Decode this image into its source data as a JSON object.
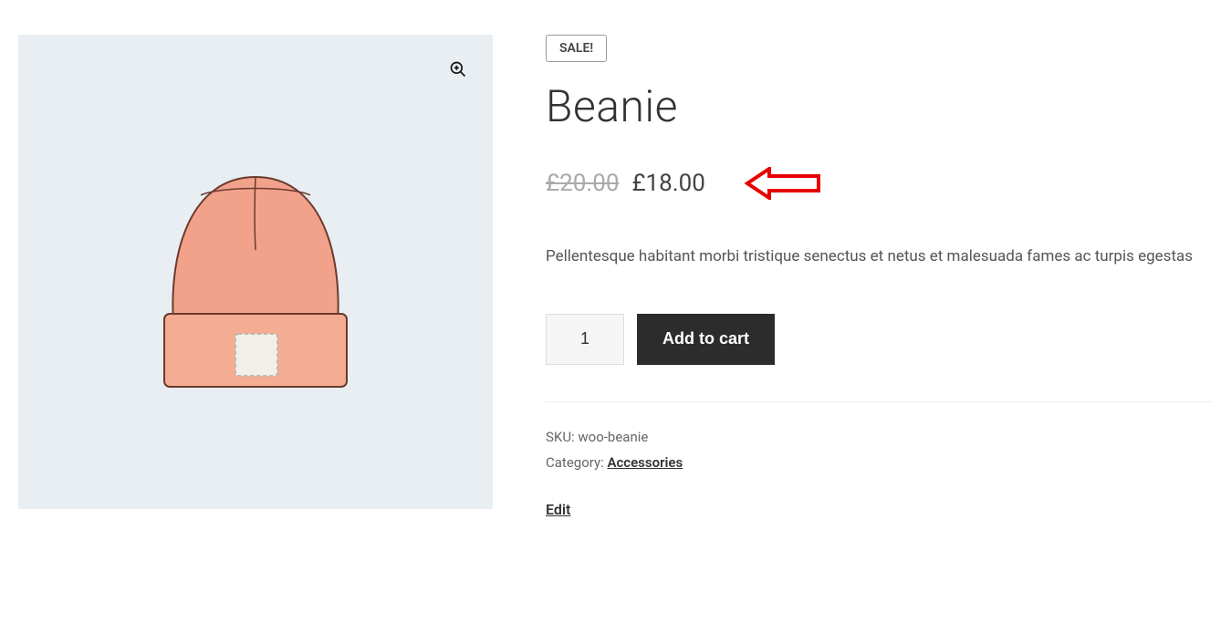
{
  "product": {
    "sale_badge": "SALE!",
    "title": "Beanie",
    "price_old": "£20.00",
    "price_new": "£18.00",
    "description": "Pellentesque habitant morbi tristique senectus et netus et malesuada fames ac turpis egestas",
    "quantity": "1",
    "add_to_cart_label": "Add to cart",
    "sku_label": "SKU: ",
    "sku_value": "woo-beanie",
    "category_label": "Category: ",
    "category_value": "Accessories",
    "edit_label": "Edit"
  },
  "icons": {
    "zoom": "zoom-in-icon"
  },
  "colors": {
    "image_bg": "#e8eef2",
    "button_bg": "#2c2c2c",
    "edit_link": "#96588a",
    "annotation_arrow": "#e60000"
  }
}
